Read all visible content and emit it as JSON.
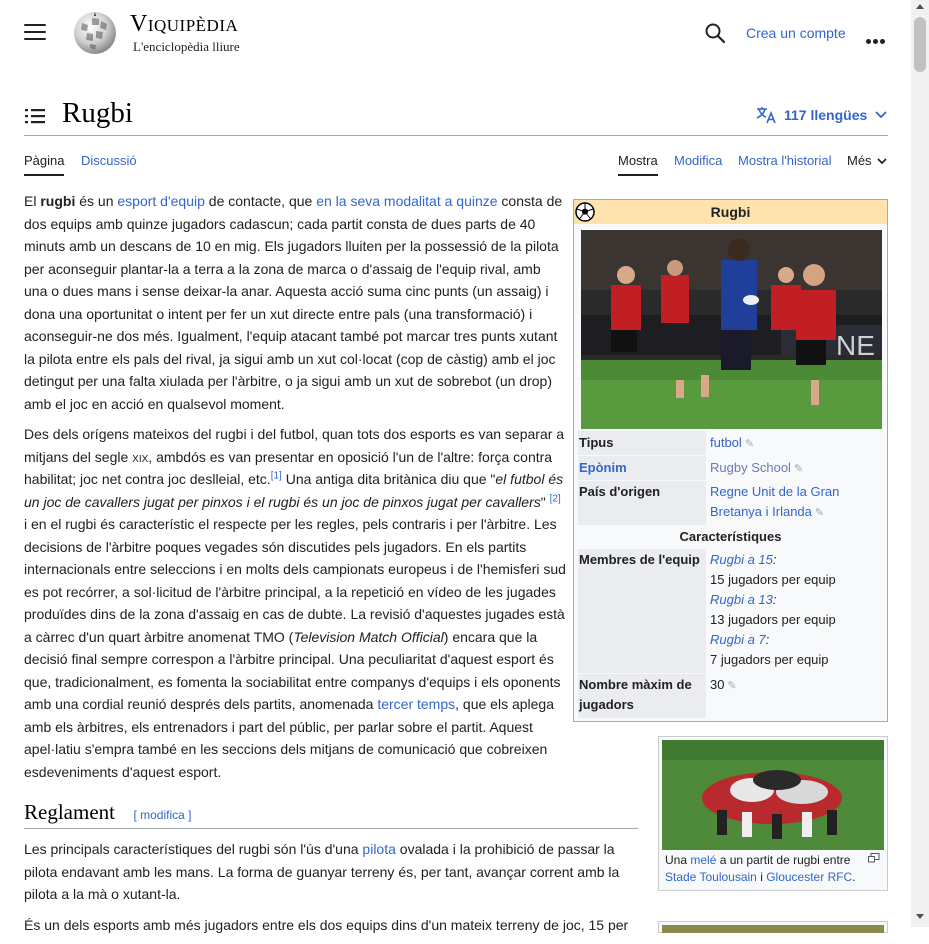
{
  "header": {
    "wordmark": "Viquipèdia",
    "tagline": "L'enciclopèdia lliure",
    "create_account": "Crea un compte"
  },
  "page": {
    "title": "Rugbi",
    "languages": "117 llengües"
  },
  "tabs": {
    "page": "Pàgina",
    "discussion": "Discussió",
    "read": "Mostra",
    "edit": "Modifica",
    "history": "Mostra l'historial",
    "more": "Més"
  },
  "body": {
    "p1": {
      "t1": "El ",
      "bold": "rugbi",
      "t2": " és un ",
      "link1": "esport d'equip",
      "t3": " de contacte, que ",
      "link2": "en la seva modalitat a quinze",
      "t4": " consta de dos equips amb quinze jugadors cadascun; cada partit consta de dues parts de 40 minuts amb un descans de 10 en mig. Els jugadors lluiten per la possessió de la pilota per aconseguir plantar-la a terra a la zona de marca o d'assaig de l'equip rival, amb una o dues mans i sense deixar-la anar. Aquesta acció suma cinc punts (un assaig) i dona una oportunitat o intent per fer un xut directe entre pals (una transformació) i aconseguir-ne dos més. Igualment, l'equip atacant també pot marcar tres punts xutant la pilota entre els pals del rival, ja sigui amb un xut col·locat (cop de càstig) amb el joc detingut per una falta xiulada per l'àrbitre, o ja sigui amb un xut de sobrebot (un drop) amb el joc en acció en qualsevol moment."
    },
    "p2": {
      "t1": "Des dels orígens mateixos del rugbi i del futbol, quan tots dos esports es van separar a mitjans del segle ",
      "century": "xix",
      "t2": ", ambdós es van presentar en oposició l'un de l'altre: força contra habilitat; joc net contra joc deslleial, etc.",
      "ref1": "[1]",
      "t3": " Una antiga dita britànica diu que \"",
      "quote": "el futbol és un joc de cavallers jugat per pinxos i el rugbi és un joc de pinxos jugat per cavallers",
      "t4": "\" ",
      "ref2": "[2]",
      "t5": " i en el rugbi és característic el respecte per les regles, pels contraris i per l'àrbitre. Les decisions de l'àrbitre poques vegades són discutides pels jugadors. En els partits internacionals entre seleccions i en molts dels campionats europeus i de l'hemisferi sud es pot recórrer, a sol·licitud de l'àrbitre principal, a la repetició en vídeo de les jugades produïdes dins de la zona d'assaig en cas de dubte. La revisió d'aquestes jugades està a càrrec d'un quart àrbitre anomenat TMO (",
      "tmo": "Television Match Official",
      "t6": ") encara que la decisió final sempre correspon a l'àrbitre principal. Una peculiaritat d'aquest esport és que, tradicionalment, es fomenta la sociabilitat entre companys d'equips i els oponents amb una cordial reunió després dels partits, anomenada ",
      "link": "tercer temps",
      "t7": ", que els aplega amb els àrbitres, els entrenadors i part del públic, per parlar sobre el partit. Aquest apel·latiu s'empra també en les seccions dels mitjans de comunicació que cobreixen esdeveniments d'aquest esport."
    },
    "section": {
      "title": "Reglament",
      "edit": "[ modifica ]"
    },
    "p3": {
      "t1": "Les principals característiques del rugbi són l'ús d'una ",
      "link": "pilota",
      "t2": " ovalada i la prohibició de passar la pilota endavant amb les mans. La forma de guanyar terreny és, per tant, avançar corrent amb la pilota a la mà o xutant-la."
    },
    "p4": "És un dels esports amb més jugadors entre els dos equips dins d'un mateix terreny de joc, 15 per"
  },
  "infobox": {
    "title": "Rugbi",
    "rows": {
      "tipus_label": "Tipus",
      "tipus_value": "futbol",
      "eponim_label": "Epònim",
      "eponim_value": "Rugby School",
      "pais_label": "País d'origen",
      "pais_value": "Regne Unit de la Gran Bretanya i Irlanda",
      "section": "Característiques",
      "membres_label": "Membres de l'equip",
      "m1_link": "Rugbi a 15",
      "m1_text": "15 jugadors per equip",
      "m2_link": "Rugbi a 13",
      "m2_text": "13 jugadors per equip",
      "m3_link": "Rugbi a 7",
      "m3_text": "7 jugadors per equip",
      "max_label": "Nombre màxim de jugadors",
      "max_value": "30"
    }
  },
  "thumb": {
    "t1": "Una ",
    "link1": "melé",
    "t2": " a un partit de rugbi entre ",
    "link2": "Stade Toulousain",
    "t3": " i ",
    "link3": "Gloucester RFC",
    "t4": "."
  },
  "colors": {
    "link": "#3366cc",
    "text": "#202122",
    "infobox_header": "#ffe3ae",
    "infobox_bg": "#f8f9fa"
  }
}
